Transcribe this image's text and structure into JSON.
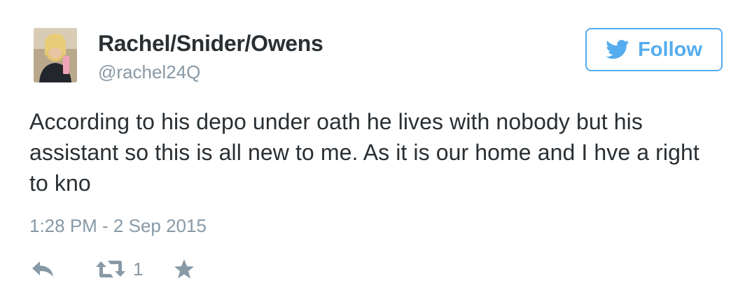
{
  "user": {
    "name": "Rachel/Snider/Owens",
    "handle": "@rachel24Q"
  },
  "follow_button": {
    "label": "Follow",
    "icon": "twitter-bird-icon"
  },
  "tweet": {
    "text": "According to his depo under oath he lives with nobody but his assistant so this is all new to me. As it is our home and I hve a right to kno",
    "timestamp": "1:28 PM - 2 Sep 2015"
  },
  "actions": {
    "reply_icon": "reply-icon",
    "retweet_icon": "retweet-icon",
    "retweet_count": "1",
    "favorite_icon": "star-icon"
  },
  "colors": {
    "accent": "#55acee",
    "text": "#292f33",
    "muted": "#8899a6"
  }
}
